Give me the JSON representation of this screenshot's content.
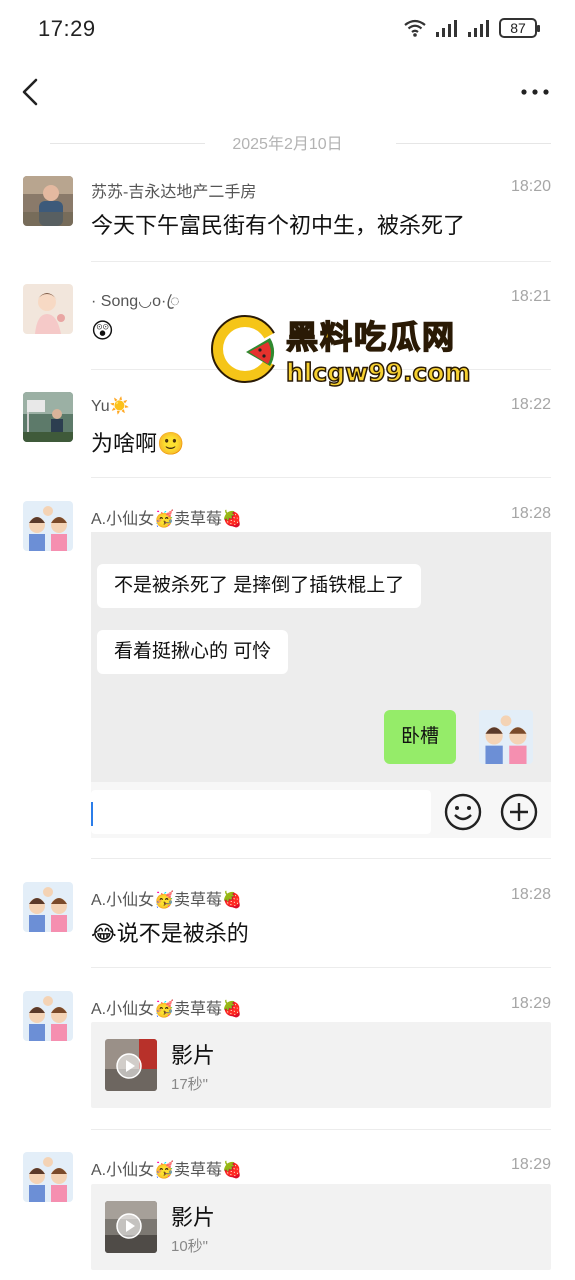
{
  "status_bar": {
    "time": "17:29",
    "battery": "87"
  },
  "date_separator": "2025年2月10日",
  "messages": [
    {
      "sender": "苏苏-吉永达地产二手房",
      "time": "18:20",
      "text": "今天下午富民街有个初中生，被杀死了"
    },
    {
      "sender": "· Song◡o·ꦿ",
      "time": "18:21",
      "text": "😲"
    },
    {
      "sender": "Yu☀️",
      "time": "18:22",
      "text": "为啥啊🙂"
    },
    {
      "sender": "A.小仙女🥳卖草莓🍓",
      "time": "18:28"
    },
    {
      "sender": "A.小仙女🥳卖草莓🍓",
      "time": "18:28",
      "text": "😂说不是被杀的"
    },
    {
      "sender": "A.小仙女🥳卖草莓🍓",
      "time": "18:29"
    },
    {
      "sender": "A.小仙女🥳卖草莓🍓",
      "time": "18:29"
    }
  ],
  "quote": {
    "bubbles": [
      "不是被杀死了 是摔倒了插铁棍上了",
      "看着挺揪心的 可怜"
    ],
    "reply": "卧槽"
  },
  "videos": [
    {
      "title": "影片",
      "duration": "17秒\""
    },
    {
      "title": "影片",
      "duration": "10秒\""
    }
  ],
  "watermark": {
    "title": "黑料吃瓜网",
    "url": "hlcgw99.com"
  }
}
